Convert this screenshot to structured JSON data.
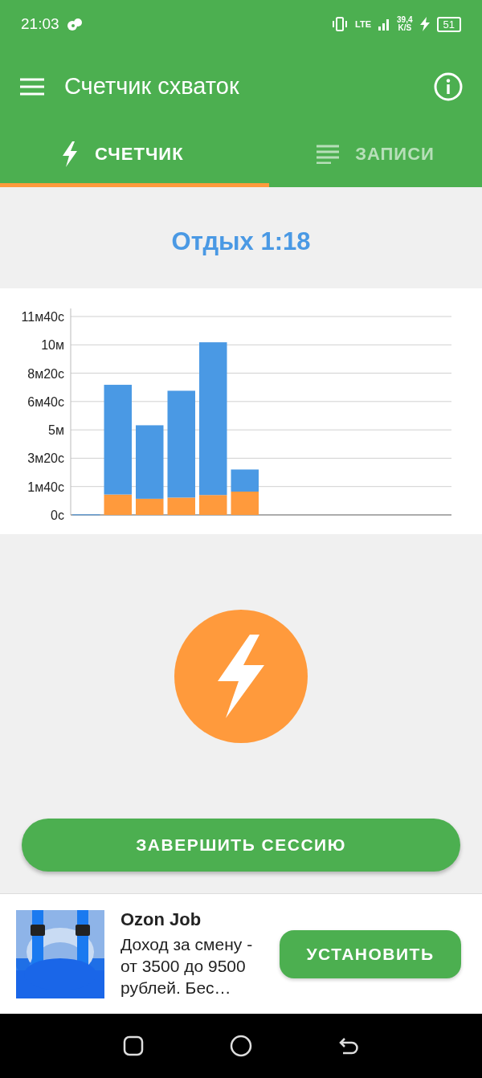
{
  "status_bar": {
    "time": "21:03",
    "network": "LTE",
    "speed": "39,4",
    "speed_unit": "K/S",
    "battery": "51"
  },
  "toolbar": {
    "title": "Счетчик схваток"
  },
  "tabs": [
    {
      "label": "СЧЕТЧИК",
      "kind": "counter",
      "selected": true
    },
    {
      "label": "ЗАПИСИ",
      "kind": "records",
      "selected": false
    }
  ],
  "rest_timer": "Отдых 1:18",
  "chart": {
    "chart_data": {
      "type": "bar",
      "stacked": true,
      "grid": true,
      "ylim": [
        0,
        11.6667
      ],
      "yticks": [
        {
          "value": 0,
          "label": "0с"
        },
        {
          "value": 1.6667,
          "label": "1м40с"
        },
        {
          "value": 3.3333,
          "label": "3м20с"
        },
        {
          "value": 5,
          "label": "5м"
        },
        {
          "value": 6.6667,
          "label": "6м40с"
        },
        {
          "value": 8.3333,
          "label": "8м20с"
        },
        {
          "value": 10,
          "label": "10м"
        },
        {
          "value": 11.6667,
          "label": "11м40с"
        }
      ],
      "series": [
        {
          "color": "#ff9a3c",
          "values": [
            0,
            1.2,
            0.95,
            1.02,
            1.17,
            1.37,
            null,
            null,
            null,
            null,
            null,
            null
          ]
        },
        {
          "color": "#4a99e4",
          "values": [
            0.03,
            6.45,
            4.32,
            6.28,
            8.98,
            1.3,
            null,
            null,
            null,
            null,
            null,
            null
          ]
        }
      ]
    }
  },
  "end_session_button": "ЗАВЕРШИТЬ СЕССИЮ",
  "ad": {
    "title": "Ozon Job",
    "text": "Доход за смену - от 3500 до 9500 рублей. Бес…",
    "button": "УСТАНОВИТЬ"
  }
}
